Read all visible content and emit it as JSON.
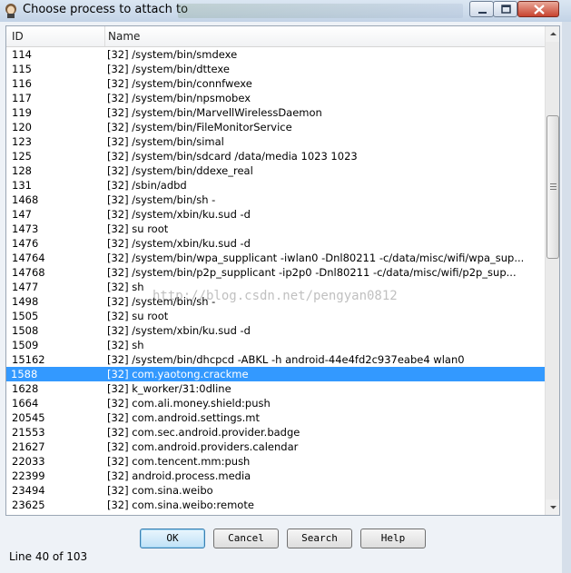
{
  "window": {
    "title": "Choose process to attach to",
    "controls": {
      "minimize": "minimize-icon",
      "maximize": "maximize-icon",
      "close": "close-icon"
    }
  },
  "list": {
    "columns": {
      "id": "ID",
      "name": "Name"
    },
    "selected_row": 22,
    "rows": [
      {
        "id": "114",
        "name": "[32] /system/bin/smdexe"
      },
      {
        "id": "115",
        "name": "[32] /system/bin/dttexe"
      },
      {
        "id": "116",
        "name": "[32] /system/bin/connfwexe"
      },
      {
        "id": "117",
        "name": "[32] /system/bin/npsmobex"
      },
      {
        "id": "119",
        "name": "[32] /system/bin/MarvellWirelessDaemon"
      },
      {
        "id": "120",
        "name": "[32] /system/bin/FileMonitorService"
      },
      {
        "id": "123",
        "name": "[32] /system/bin/simal"
      },
      {
        "id": "125",
        "name": "[32] /system/bin/sdcard /data/media 1023 1023"
      },
      {
        "id": "128",
        "name": "[32] /system/bin/ddexe_real"
      },
      {
        "id": "131",
        "name": "[32] /sbin/adbd"
      },
      {
        "id": "1468",
        "name": "[32] /system/bin/sh -"
      },
      {
        "id": "147",
        "name": "[32] /system/xbin/ku.sud -d"
      },
      {
        "id": "1473",
        "name": "[32] su root"
      },
      {
        "id": "1476",
        "name": "[32] /system/xbin/ku.sud -d"
      },
      {
        "id": "14764",
        "name": "[32] /system/bin/wpa_supplicant -iwlan0 -Dnl80211 -c/data/misc/wifi/wpa_sup..."
      },
      {
        "id": "14768",
        "name": "[32] /system/bin/p2p_supplicant -ip2p0 -Dnl80211 -c/data/misc/wifi/p2p_sup..."
      },
      {
        "id": "1477",
        "name": "[32] sh"
      },
      {
        "id": "1498",
        "name": "[32] /system/bin/sh -"
      },
      {
        "id": "1505",
        "name": "[32] su root"
      },
      {
        "id": "1508",
        "name": "[32] /system/xbin/ku.sud -d"
      },
      {
        "id": "1509",
        "name": "[32] sh"
      },
      {
        "id": "15162",
        "name": "[32] /system/bin/dhcpcd -ABKL -h android-44e4fd2c937eabe4 wlan0"
      },
      {
        "id": "1588",
        "name": "[32] com.yaotong.crackme"
      },
      {
        "id": "1628",
        "name": "[32] k_worker/31:0dline"
      },
      {
        "id": "1664",
        "name": "[32] com.ali.money.shield:push"
      },
      {
        "id": "20545",
        "name": "[32] com.android.settings.mt"
      },
      {
        "id": "21553",
        "name": "[32] com.sec.android.provider.badge"
      },
      {
        "id": "21627",
        "name": "[32] com.android.providers.calendar"
      },
      {
        "id": "22033",
        "name": "[32] com.tencent.mm:push"
      },
      {
        "id": "22399",
        "name": "[32] android.process.media"
      },
      {
        "id": "23494",
        "name": "[32] com.sina.weibo"
      },
      {
        "id": "23625",
        "name": "[32] com.sina.weibo:remote"
      }
    ]
  },
  "watermark": "http://blog.csdn.net/pengyan0812",
  "buttons": {
    "ok": "OK",
    "cancel": "Cancel",
    "search": "Search",
    "help": "Help"
  },
  "status": "Line 40 of 103",
  "colors": {
    "selection": "#3399ff"
  }
}
